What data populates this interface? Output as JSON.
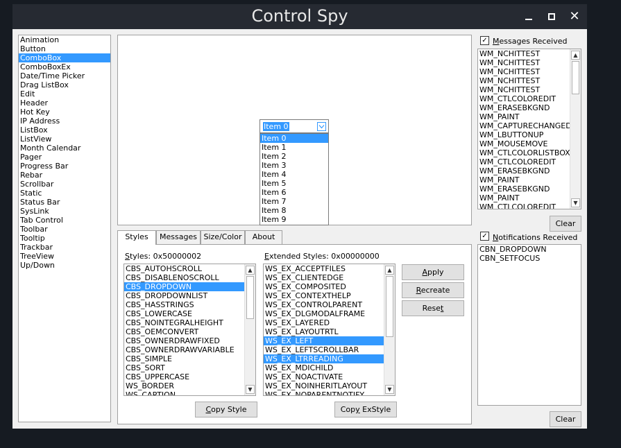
{
  "window": {
    "title": "Control Spy"
  },
  "controls": [
    "Animation",
    "Button",
    "ComboBox",
    "ComboBoxEx",
    "Date/Time Picker",
    "Drag ListBox",
    "Edit",
    "Header",
    "Hot Key",
    "IP Address",
    "ListBox",
    "ListView",
    "Month Calendar",
    "Pager",
    "Progress Bar",
    "Rebar",
    "Scrollbar",
    "Static",
    "Status Bar",
    "SysLink",
    "Tab Control",
    "Toolbar",
    "Tooltip",
    "Trackbar",
    "TreeView",
    "Up/Down"
  ],
  "selected_control": "ComboBox",
  "combo": {
    "value": "Item 0",
    "items": [
      "Item 0",
      "Item 1",
      "Item 2",
      "Item 3",
      "Item 4",
      "Item 5",
      "Item 6",
      "Item 7",
      "Item 8",
      "Item 9"
    ],
    "highlighted": "Item 0"
  },
  "tabs": [
    "Styles",
    "Messages",
    "Size/Color",
    "About"
  ],
  "active_tab": "Styles",
  "styles": {
    "label_prefix": "S",
    "label_rest": "tyles: 0x50000002",
    "items": [
      "CBS_AUTOHSCROLL",
      "CBS_DISABLENOSCROLL",
      "CBS_DROPDOWN",
      "CBS_DROPDOWNLIST",
      "CBS_HASSTRINGS",
      "CBS_LOWERCASE",
      "CBS_NOINTEGRALHEIGHT",
      "CBS_OEMCONVERT",
      "CBS_OWNERDRAWFIXED",
      "CBS_OWNERDRAWVARIABLE",
      "CBS_SIMPLE",
      "CBS_SORT",
      "CBS_UPPERCASE",
      "WS_BORDER",
      "WS_CAPTION"
    ],
    "selected": [
      "CBS_DROPDOWN"
    ],
    "copy_button_prefix": "C",
    "copy_button_rest": "opy Style"
  },
  "ex_styles": {
    "label_prefix": "E",
    "label_rest": "xtended Styles: 0x00000000",
    "items": [
      "WS_EX_ACCEPTFILES",
      "WS_EX_CLIENTEDGE",
      "WS_EX_COMPOSITED",
      "WS_EX_CONTEXTHELP",
      "WS_EX_CONTROLPARENT",
      "WS_EX_DLGMODALFRAME",
      "WS_EX_LAYERED",
      "WS_EX_LAYOUTRTL",
      "WS_EX_LEFT",
      "WS_EX_LEFTSCROLLBAR",
      "WS_EX_LTRREADING",
      "WS_EX_MDICHILD",
      "WS_EX_NOACTIVATE",
      "WS_EX_NOINHERITLAYOUT",
      "WS_EX_NOPARENTNOTIFY"
    ],
    "selected": [
      "WS_EX_LEFT",
      "WS_EX_LTRREADING"
    ],
    "copy_button_prefix": "y",
    "copy_button_before": "Cop",
    "copy_button_after": " ExStyle"
  },
  "action_buttons": {
    "apply_prefix": "A",
    "apply_rest": "pply",
    "recreate_prefix": "R",
    "recreate_rest": "ecreate",
    "reset_before": "Rese",
    "reset_prefix": "t",
    "reset_rest": ""
  },
  "messages": {
    "checkbox_label_prefix": "M",
    "checkbox_label_rest": "essages Received",
    "checked": true,
    "items": [
      "WM_NCHITTEST",
      "WM_NCHITTEST",
      "WM_NCHITTEST",
      "WM_NCHITTEST",
      "WM_NCHITTEST",
      "WM_CTLCOLOREDIT",
      "WM_ERASEBKGND",
      "WM_PAINT",
      "WM_CAPTURECHANGED",
      "WM_LBUTTONUP",
      "WM_MOUSEMOVE",
      "WM_CTLCOLORLISTBOX",
      "WM_CTLCOLOREDIT",
      "WM_ERASEBKGND",
      "WM_PAINT",
      "WM_ERASEBKGND",
      "WM_PAINT",
      "WM_CTLCOLOREDIT"
    ],
    "clear_label": "Clear"
  },
  "notifications": {
    "checkbox_label_prefix": "N",
    "checkbox_label_rest": "otifications Received",
    "checked": true,
    "items": [
      "CBN_DROPDOWN",
      "CBN_SETFOCUS"
    ],
    "clear_label": "Clear"
  },
  "colors": {
    "selection": "#3399ff",
    "titlebar": "#262a32",
    "background": "#161b22"
  }
}
